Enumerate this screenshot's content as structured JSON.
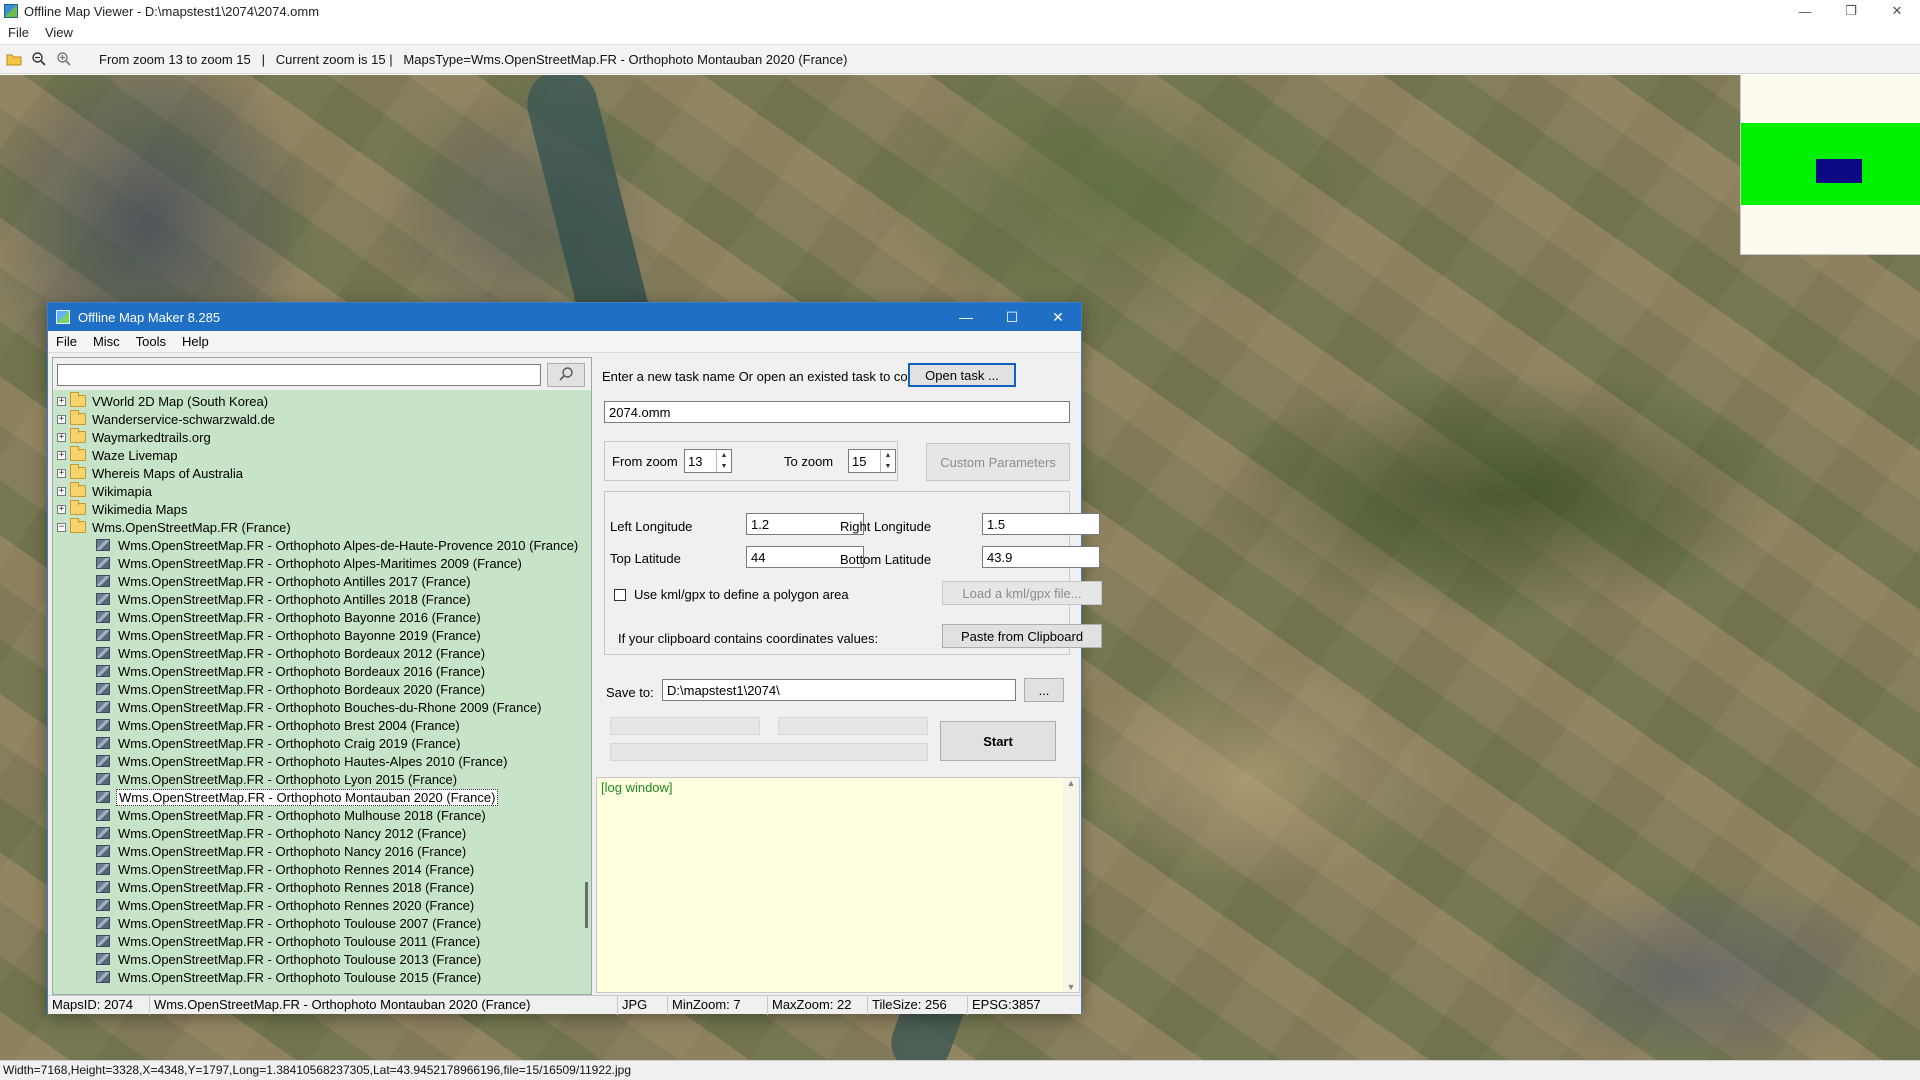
{
  "viewer": {
    "title": "Offline Map Viewer - D:\\mapstest1\\2074\\2074.omm",
    "menu": [
      "File",
      "View"
    ],
    "toolbar_info": "From zoom 13 to zoom 15   |   Current zoom is 15 |   MapsType=Wms.OpenStreetMap.FR - Orthophoto Montauban 2020 (France)",
    "icons": [
      "open-folder-icon",
      "zoom-out-icon",
      "zoom-in-icon"
    ],
    "status": "Width=7168,Height=3328,X=4348,Y=1797,Long=1.38410568237305,Lat=43.9452178966196,file=15/16509/11922.jpg",
    "overview_colors": {
      "background": "#fdfbef",
      "area": "#00f000",
      "view": "#0a0a82"
    }
  },
  "maker": {
    "title": "Offline Map Maker 8.285",
    "menu": [
      "File",
      "Misc",
      "Tools",
      "Help"
    ],
    "search": {
      "value": "",
      "placeholder": ""
    },
    "tree": [
      {
        "type": "folder",
        "label": "VWorld 2D Map (South Korea)",
        "expanded": false
      },
      {
        "type": "folder",
        "label": "Wanderservice-schwarzwald.de",
        "expanded": false
      },
      {
        "type": "folder",
        "label": "Waymarkedtrails.org",
        "expanded": false
      },
      {
        "type": "folder",
        "label": "Waze Livemap",
        "expanded": false
      },
      {
        "type": "folder",
        "label": "Whereis Maps of Australia",
        "expanded": false
      },
      {
        "type": "folder",
        "label": "Wikimapia",
        "expanded": false
      },
      {
        "type": "folder",
        "label": "Wikimedia Maps",
        "expanded": false
      },
      {
        "type": "folder",
        "label": "Wms.OpenStreetMap.FR (France)",
        "expanded": true
      },
      {
        "type": "map",
        "label": "Wms.OpenStreetMap.FR - Orthophoto Alpes-de-Haute-Provence 2010 (France)"
      },
      {
        "type": "map",
        "label": "Wms.OpenStreetMap.FR - Orthophoto Alpes-Maritimes 2009 (France)"
      },
      {
        "type": "map",
        "label": "Wms.OpenStreetMap.FR - Orthophoto Antilles 2017 (France)"
      },
      {
        "type": "map",
        "label": "Wms.OpenStreetMap.FR - Orthophoto Antilles 2018 (France)"
      },
      {
        "type": "map",
        "label": "Wms.OpenStreetMap.FR - Orthophoto Bayonne 2016 (France)"
      },
      {
        "type": "map",
        "label": "Wms.OpenStreetMap.FR - Orthophoto Bayonne 2019 (France)"
      },
      {
        "type": "map",
        "label": "Wms.OpenStreetMap.FR - Orthophoto Bordeaux 2012 (France)"
      },
      {
        "type": "map",
        "label": "Wms.OpenStreetMap.FR - Orthophoto Bordeaux 2016 (France)"
      },
      {
        "type": "map",
        "label": "Wms.OpenStreetMap.FR - Orthophoto Bordeaux 2020 (France)"
      },
      {
        "type": "map",
        "label": "Wms.OpenStreetMap.FR - Orthophoto Bouches-du-Rhone 2009 (France)"
      },
      {
        "type": "map",
        "label": "Wms.OpenStreetMap.FR - Orthophoto Brest 2004 (France)"
      },
      {
        "type": "map",
        "label": "Wms.OpenStreetMap.FR - Orthophoto Craig 2019 (France)"
      },
      {
        "type": "map",
        "label": "Wms.OpenStreetMap.FR - Orthophoto Hautes-Alpes 2010 (France)"
      },
      {
        "type": "map",
        "label": "Wms.OpenStreetMap.FR - Orthophoto Lyon 2015 (France)"
      },
      {
        "type": "map",
        "label": "Wms.OpenStreetMap.FR - Orthophoto Montauban 2020 (France)",
        "selected": true
      },
      {
        "type": "map",
        "label": "Wms.OpenStreetMap.FR - Orthophoto Mulhouse 2018 (France)"
      },
      {
        "type": "map",
        "label": "Wms.OpenStreetMap.FR - Orthophoto Nancy 2012 (France)"
      },
      {
        "type": "map",
        "label": "Wms.OpenStreetMap.FR - Orthophoto Nancy 2016 (France)"
      },
      {
        "type": "map",
        "label": "Wms.OpenStreetMap.FR - Orthophoto Rennes 2014 (France)"
      },
      {
        "type": "map",
        "label": "Wms.OpenStreetMap.FR - Orthophoto Rennes 2018 (France)"
      },
      {
        "type": "map",
        "label": "Wms.OpenStreetMap.FR - Orthophoto Rennes 2020 (France)"
      },
      {
        "type": "map",
        "label": "Wms.OpenStreetMap.FR - Orthophoto Toulouse 2007 (France)"
      },
      {
        "type": "map",
        "label": "Wms.OpenStreetMap.FR - Orthophoto Toulouse 2011 (France)"
      },
      {
        "type": "map",
        "label": "Wms.OpenStreetMap.FR - Orthophoto Toulouse 2013 (France)"
      },
      {
        "type": "map",
        "label": "Wms.OpenStreetMap.FR - Orthophoto Toulouse 2015 (France)"
      }
    ],
    "task": {
      "prompt": "Enter a new task name Or open an existed task to continue:",
      "open_task_label": "Open task ...",
      "task_name": "2074.omm"
    },
    "zoom": {
      "from_label": "From zoom",
      "from_value": "13",
      "to_label": "To zoom",
      "to_value": "15",
      "custom_params_label": "Custom Parameters"
    },
    "coords": {
      "left_lon_label": "Left Longitude",
      "left_lon": "1.2",
      "right_lon_label": "Right Longitude",
      "right_lon": "1.5",
      "top_lat_label": "Top Latitude",
      "top_lat": "44",
      "bottom_lat_label": "Bottom Latitude",
      "bottom_lat": "43.9",
      "kml_checkbox_label": "Use kml/gpx to define a polygon area",
      "kml_checked": false,
      "load_kml_label": "Load a kml/gpx file...",
      "clipboard_prompt": "If your clipboard contains coordinates values:",
      "paste_label": "Paste from Clipboard"
    },
    "save": {
      "label": "Save to:",
      "path": "D:\\mapstest1\\2074\\",
      "browse_label": "..."
    },
    "start_label": "Start",
    "log_text": "[log window]",
    "status": {
      "maps_id": "MapsID: 2074",
      "maps_name": "Wms.OpenStreetMap.FR - Orthophoto Montauban 2020 (France)",
      "format": "JPG",
      "min_zoom": "MinZoom: 7",
      "max_zoom": "MaxZoom: 22",
      "tile_size": "TileSize: 256",
      "epsg": "EPSG:3857"
    }
  }
}
